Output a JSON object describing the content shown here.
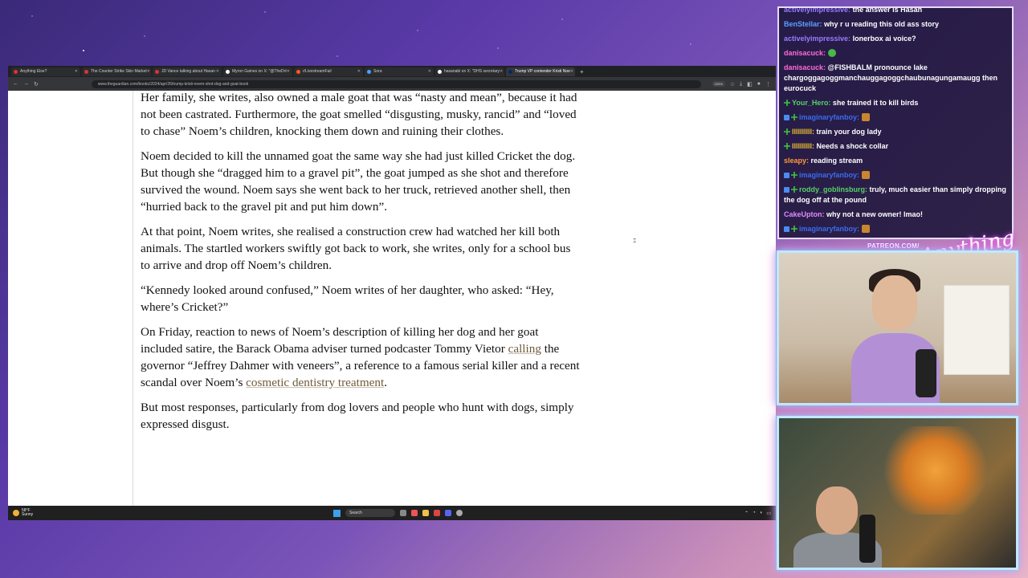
{
  "browser": {
    "tabs": [
      {
        "title": "Anything Else?",
        "active": false
      },
      {
        "title": "The Counter Strike Skin Market",
        "active": false
      },
      {
        "title": "JD Vance talking about Hasan",
        "active": false
      },
      {
        "title": "Myron Gaines on X: \"@TheDrt",
        "active": false
      },
      {
        "title": "r/LivestreamFail",
        "active": false
      },
      {
        "title": "Sora",
        "active": false
      },
      {
        "title": "hasanabi on X: \"DHS secretary",
        "active": false
      },
      {
        "title": "Trump VP contender Kristi Noe",
        "active": true
      }
    ],
    "new_tab": "+",
    "url": "www.theguardian.com/books/2024/apr/26/trump-kristi-noem-shot-dog-and-goat-book",
    "zoom": "220%"
  },
  "article": {
    "p1": "Her family, she writes, also owned a male goat that was “nasty and mean”, because it had not been castrated. Furthermore, the goat smelled “disgusting, musky, rancid” and “loved to chase” Noem’s children, knocking them down and ruining their clothes.",
    "p2": "Noem decided to kill the unnamed goat the same way she had just killed Cricket the dog. But though she “dragged him to a gravel pit”, the goat jumped as she shot and therefore survived the wound. Noem says she went back to her truck, retrieved another shell, then “hurried back to the gravel pit and put him down”.",
    "p3": "At that point, Noem writes, she realised a construction crew had watched her kill both animals. The startled workers swiftly got back to work, she writes, only for a school bus to arrive and drop off Noem’s children.",
    "p4": "“Kennedy looked around confused,” Noem writes of her daughter, who asked: “Hey, where’s Cricket?”",
    "p5_a": "On Friday, reaction to news of Noem’s description of killing her dog and her goat included satire, the Barack Obama adviser turned podcaster Tommy Vietor ",
    "p5_link1": "calling",
    "p5_b": " the governor “Jeffrey Dahmer with veneers”, a reference to a famous serial killer and a recent scandal over Noem’s ",
    "p5_link2": "cosmetic dentistry treatment",
    "p5_c": ".",
    "p6": "But most responses, particularly from dog lovers and people who hunt with dogs, simply expressed disgust."
  },
  "taskbar": {
    "weather_temp": "58°F",
    "weather_desc": "Sunny",
    "search_placeholder": "Search"
  },
  "chat": {
    "messages": [
      {
        "user": "activelyimpressive:",
        "text": "the answer is Hasan",
        "color": "#9a7cff"
      },
      {
        "user": "BenStellar:",
        "text": "why r u reading this old ass story",
        "color": "#5aa0ff"
      },
      {
        "user": "activelyimpressive:",
        "text": "lonerbox ai voice?",
        "color": "#9a7cff"
      },
      {
        "user": "danisacuck:",
        "text": "",
        "color": "#ff6ad5"
      },
      {
        "user": "danisacuck:",
        "text": "@FISHBALM pronounce lake chargoggagoggmanchauggagoggchaubunagungamaugg then eurocuck",
        "color": "#ff6ad5"
      },
      {
        "user": "Your_Hero:",
        "text": "she trained it to kill birds",
        "color": "#56d16a"
      },
      {
        "user": "imaginaryfanboy:",
        "text": "",
        "color": "#3a6cf0"
      },
      {
        "user": "llllllllll:",
        "text": "train your dog lady",
        "color": "#f0c030"
      },
      {
        "user": "llllllllll:",
        "text": "Needs a shock collar",
        "color": "#f0c030"
      },
      {
        "user": "sleapy:",
        "text": "reading stream",
        "color": "#ff9a3a"
      },
      {
        "user": "imaginaryfanboy:",
        "text": "",
        "color": "#3a6cf0"
      },
      {
        "user": "roddy_goblinsburg:",
        "text": "truly, much easier than simply dropping the dog off at the pound",
        "color": "#56d16a"
      },
      {
        "user": "CakeUpton:",
        "text": "why not a new owner! lmao!",
        "color": "#e08aff"
      },
      {
        "user": "imaginaryfanboy:",
        "text": "",
        "color": "#3a6cf0"
      }
    ]
  },
  "overlay": {
    "patreon": "PATREON.COM/",
    "logo": "Anything Else?"
  }
}
